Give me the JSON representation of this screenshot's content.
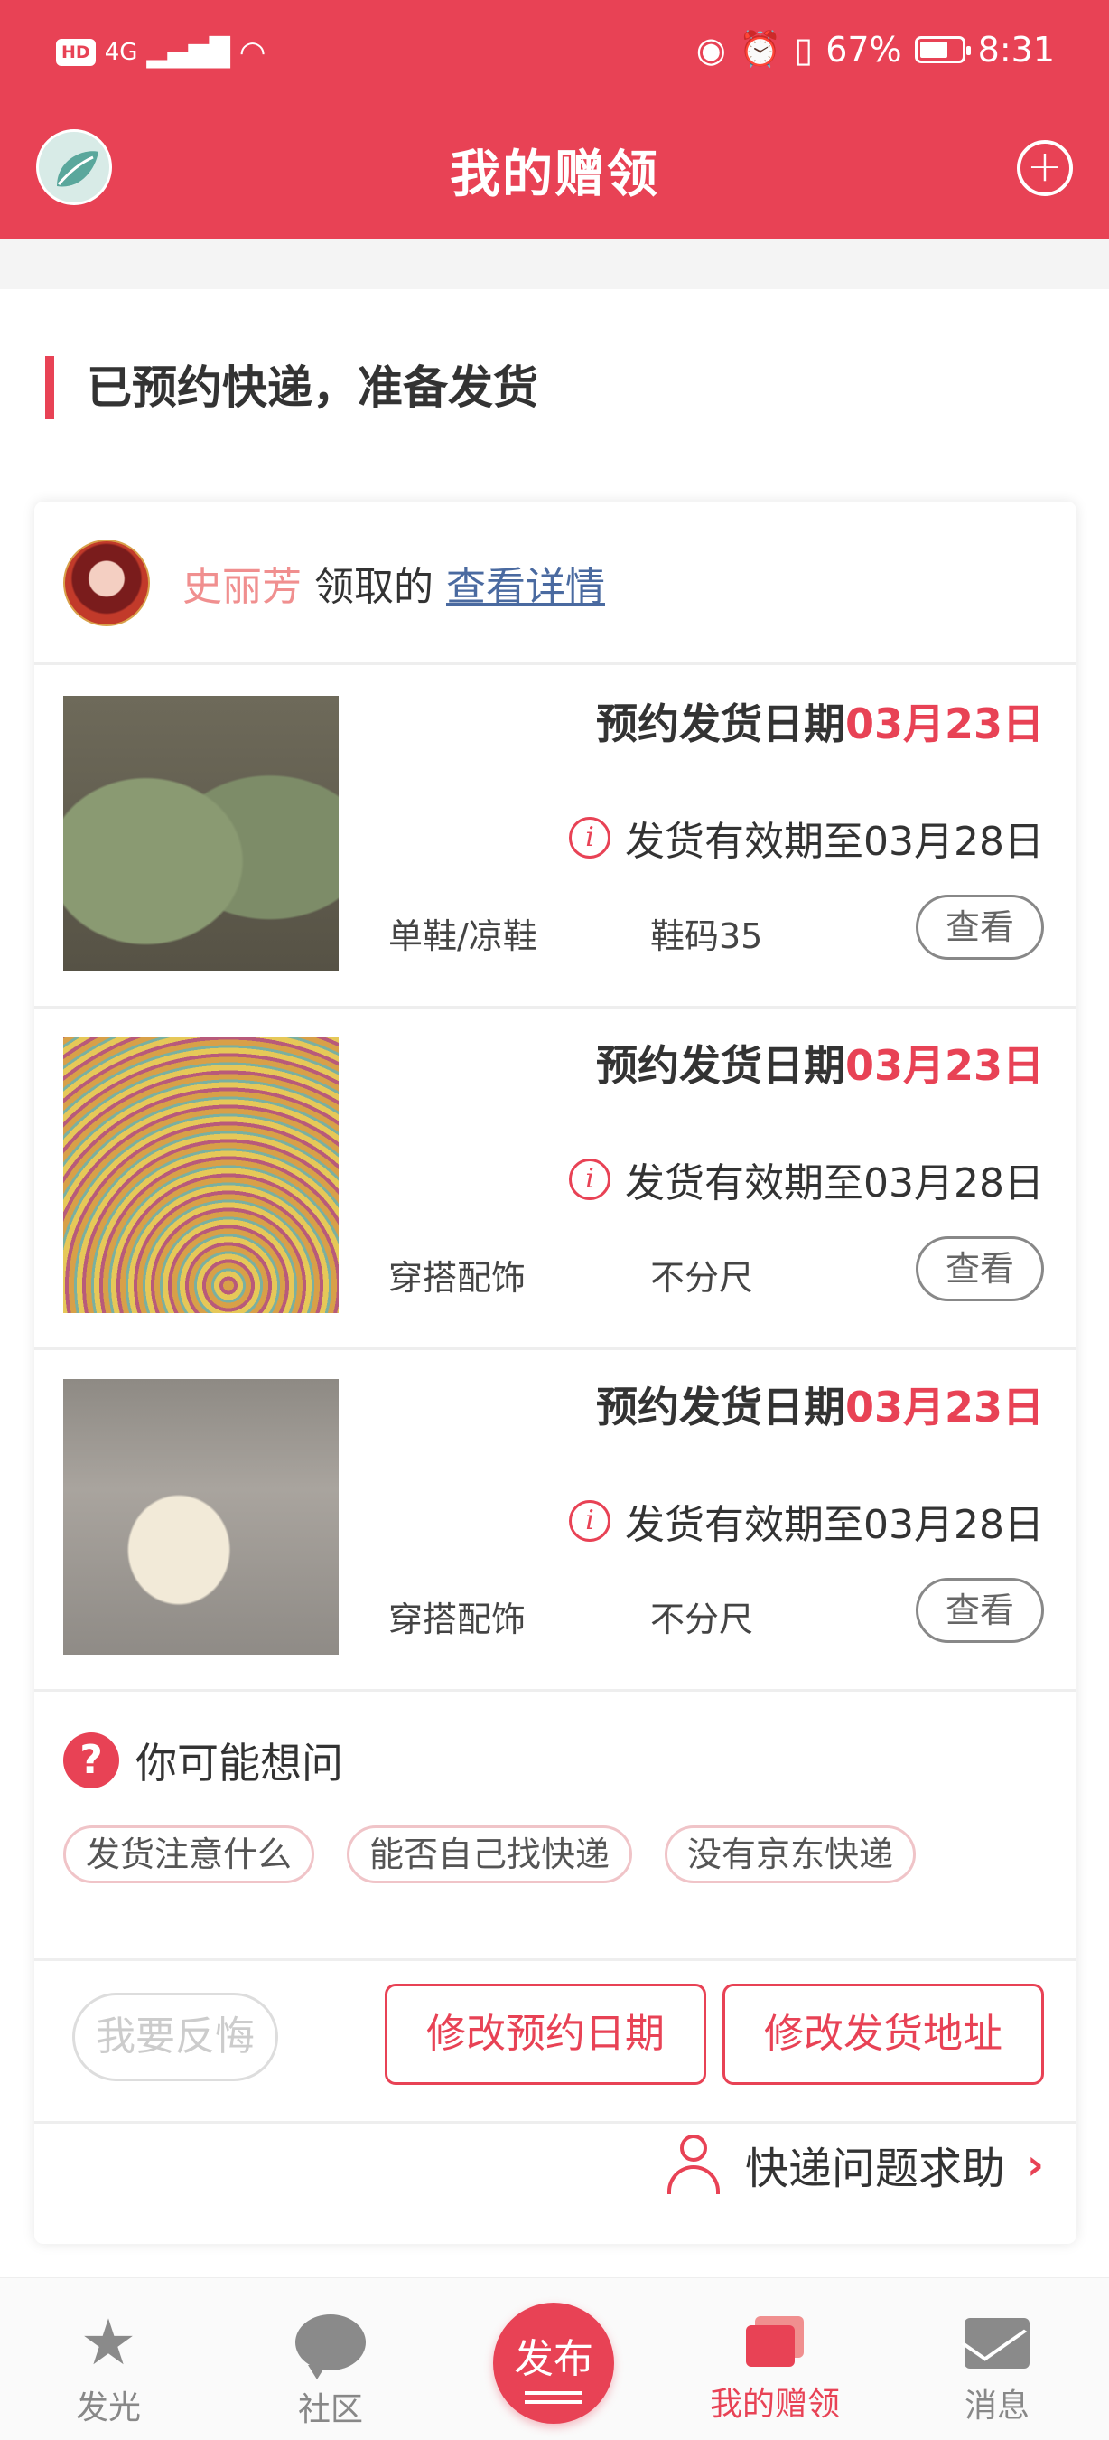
{
  "status_bar": {
    "left_badges": [
      "HD",
      "4G"
    ],
    "battery": "67%",
    "time": "8:31"
  },
  "header": {
    "title": "我的赠领",
    "add_icon": "plus-circle-icon"
  },
  "section": {
    "title": "已预约快递，准备发货"
  },
  "receiver": {
    "name": "史丽芳",
    "action_text": "领取的",
    "link_text": "查看详情"
  },
  "items": [
    {
      "date_label": "预约发货日期",
      "date_value": "03月23日",
      "valid_text": "发货有效期至03月28日",
      "category": "单鞋/凉鞋",
      "size": "鞋码35",
      "view_label": "查看"
    },
    {
      "date_label": "预约发货日期",
      "date_value": "03月23日",
      "valid_text": "发货有效期至03月28日",
      "category": "穿搭配饰",
      "size": "不分尺",
      "view_label": "查看"
    },
    {
      "date_label": "预约发货日期",
      "date_value": "03月23日",
      "valid_text": "发货有效期至03月28日",
      "category": "穿搭配饰",
      "size": "不分尺",
      "view_label": "查看"
    }
  ],
  "faq": {
    "title": "你可能想问",
    "chips": [
      "发货注意什么",
      "能否自己找快递",
      "没有京东快递"
    ]
  },
  "actions": {
    "regret": "我要反悔",
    "change_date": "修改预约日期",
    "change_address": "修改发货地址"
  },
  "help": {
    "label": "快递问题求助"
  },
  "tabbar": {
    "tabs": [
      {
        "label": "发光",
        "icon": "star-icon"
      },
      {
        "label": "社区",
        "icon": "chat-bubble-icon"
      },
      {
        "label": "发布",
        "icon": "publish-icon"
      },
      {
        "label": "我的赠领",
        "icon": "gift-card-icon",
        "active": true
      },
      {
        "label": "消息",
        "icon": "mail-icon"
      }
    ]
  },
  "colors": {
    "brand": "#e84255",
    "link": "#4a6aa0",
    "receiver_name": "#f08f8f"
  }
}
